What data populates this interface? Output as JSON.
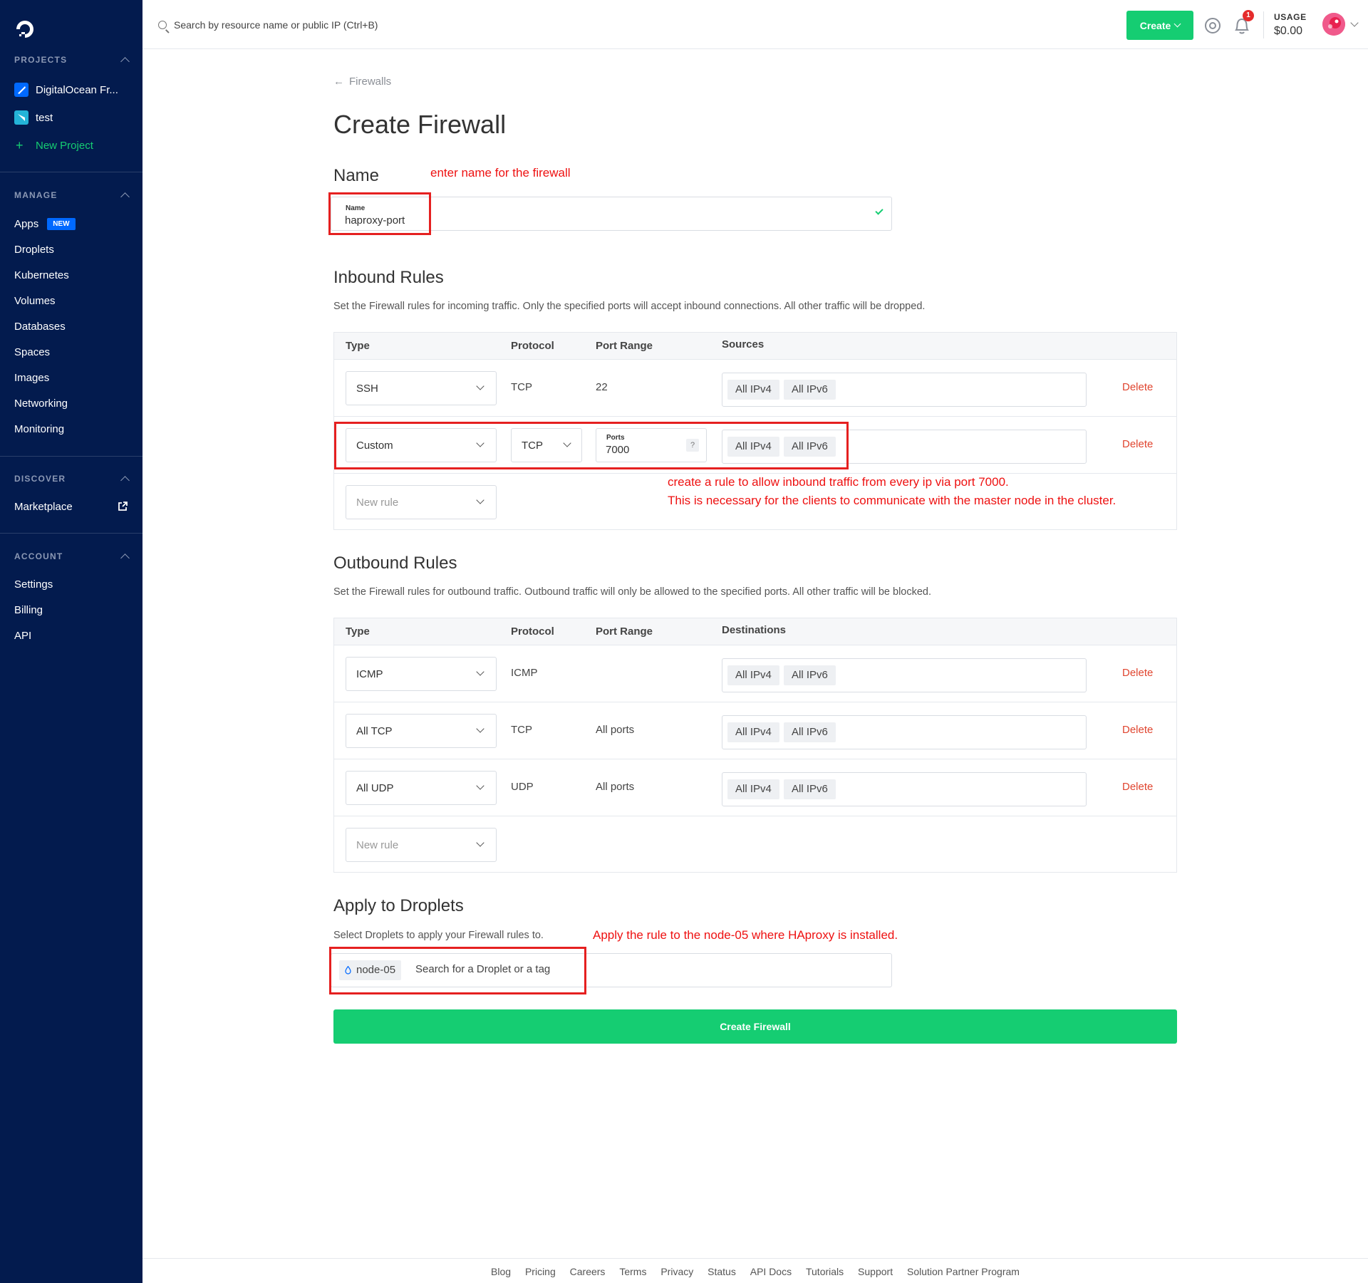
{
  "sidebar": {
    "projects_heading": "PROJECTS",
    "projects": [
      {
        "label": "DigitalOcean Fr...",
        "color": "#0069ff"
      },
      {
        "label": "test",
        "color": "#24b4d8"
      }
    ],
    "new_project": "New Project",
    "manage_heading": "MANAGE",
    "manage_items": [
      "Apps",
      "Droplets",
      "Kubernetes",
      "Volumes",
      "Databases",
      "Spaces",
      "Images",
      "Networking",
      "Monitoring"
    ],
    "new_badge": "NEW",
    "discover_heading": "DISCOVER",
    "marketplace": "Marketplace",
    "account_heading": "ACCOUNT",
    "account_items": [
      "Settings",
      "Billing",
      "API"
    ]
  },
  "topbar": {
    "search_placeholder": "Search by resource name or public IP (Ctrl+B)",
    "create_label": "Create",
    "notification_count": "1",
    "usage_label": "USAGE",
    "usage_value": "$0.00"
  },
  "page": {
    "back_label": "Firewalls",
    "title": "Create Firewall",
    "name_section": "Name",
    "name_field_label": "Name",
    "name_value": "haproxy-port",
    "annotation_name": "enter name for the firewall",
    "inbound_title": "Inbound Rules",
    "inbound_desc": "Set the Firewall rules for incoming traffic. Only the specified ports will accept inbound connections. All other traffic will be dropped.",
    "inbound_headers": {
      "type": "Type",
      "protocol": "Protocol",
      "port_range": "Port Range",
      "sources": "Sources"
    },
    "inbound_rules": [
      {
        "type": "SSH",
        "protocol": "TCP",
        "port": "22",
        "ipv4": "All IPv4",
        "ipv6": "All IPv6",
        "delete": "Delete"
      },
      {
        "type": "Custom",
        "protocol": "TCP",
        "ports_label": "Ports",
        "port": "7000",
        "help": "?",
        "ipv4": "All IPv4",
        "ipv6": "All IPv6",
        "delete": "Delete"
      }
    ],
    "new_rule": "New rule",
    "annotation_inbound_1": "create a rule to allow inbound traffic from every ip via port 7000.",
    "annotation_inbound_2": "This is necessary for the clients to communicate with the master node in the cluster.",
    "outbound_title": "Outbound Rules",
    "outbound_desc": "Set the Firewall rules for outbound traffic. Outbound traffic will only be allowed to the specified ports. All other traffic will be blocked.",
    "outbound_headers": {
      "type": "Type",
      "protocol": "Protocol",
      "port_range": "Port Range",
      "destinations": "Destinations"
    },
    "outbound_rules": [
      {
        "type": "ICMP",
        "protocol": "ICMP",
        "port": "",
        "ipv4": "All IPv4",
        "ipv6": "All IPv6",
        "delete": "Delete"
      },
      {
        "type": "All TCP",
        "protocol": "TCP",
        "port": "All ports",
        "ipv4": "All IPv4",
        "ipv6": "All IPv6",
        "delete": "Delete"
      },
      {
        "type": "All UDP",
        "protocol": "UDP",
        "port": "All ports",
        "ipv4": "All IPv4",
        "ipv6": "All IPv6",
        "delete": "Delete"
      }
    ],
    "apply_title": "Apply to Droplets",
    "apply_desc": "Select Droplets to apply your Firewall rules to.",
    "annotation_apply": "Apply the rule to the  node-05 where HAproxy is installed.",
    "droplet_chip": "node-05",
    "droplet_placeholder": "Search for a Droplet or a tag",
    "create_button": "Create Firewall"
  },
  "footer": {
    "links": [
      "Blog",
      "Pricing",
      "Careers",
      "Terms",
      "Privacy",
      "Status",
      "API Docs",
      "Tutorials",
      "Support",
      "Solution Partner Program"
    ]
  },
  "colors": {
    "sidebar_bg": "#031b4e",
    "accent_green": "#15cd72",
    "delete_red": "#e0452f",
    "annotation_red": "#ee1111",
    "brand_blue": "#0069ff"
  }
}
